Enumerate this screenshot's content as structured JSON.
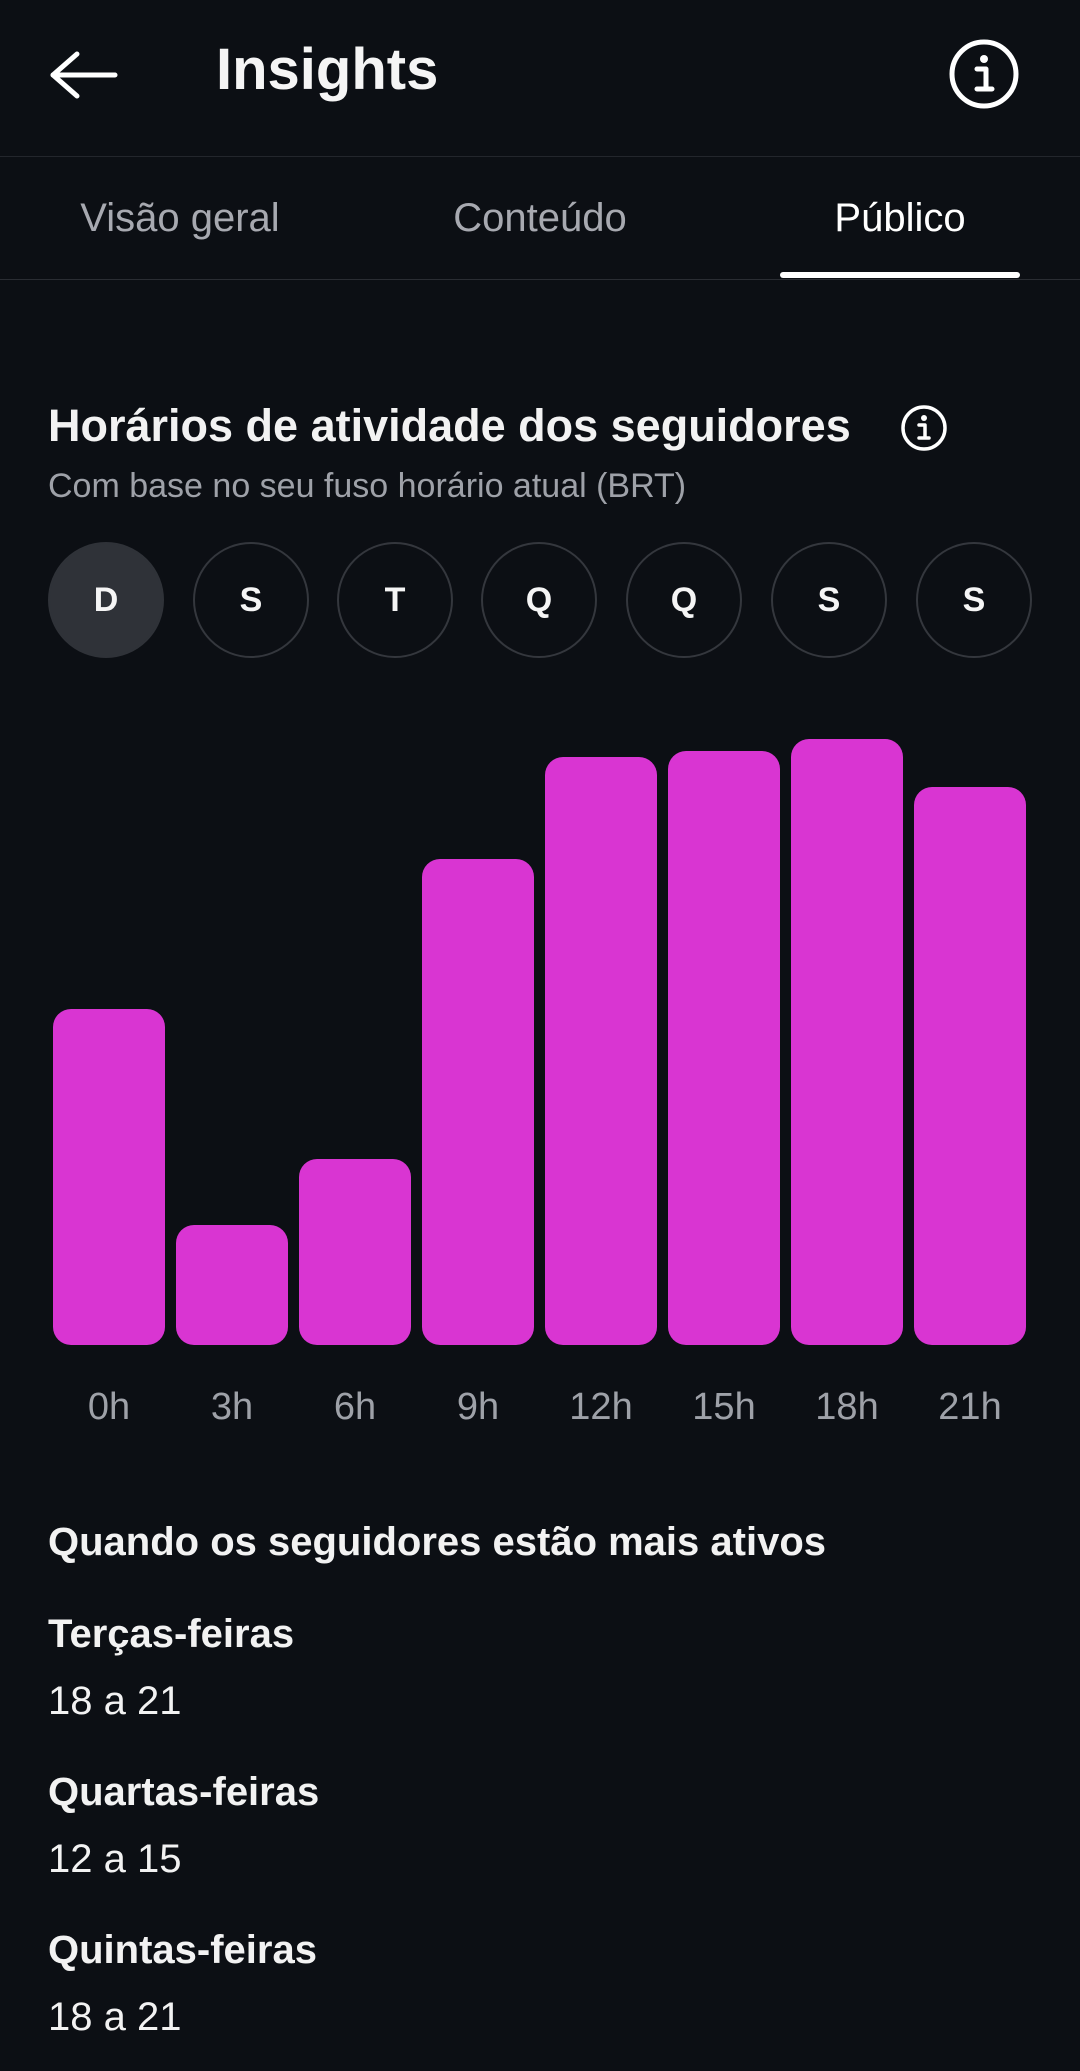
{
  "header": {
    "title": "Insights",
    "back_icon": "arrow-left-icon",
    "info_icon": "info-icon"
  },
  "tabs": [
    {
      "label": "Visão geral",
      "active": false
    },
    {
      "label": "Conteúdo",
      "active": false
    },
    {
      "label": "Público",
      "active": true
    }
  ],
  "section": {
    "title": "Horários de atividade dos seguidores",
    "subtitle": "Com base no seu fuso horário atual (BRT)",
    "info_icon": "info-icon"
  },
  "days": [
    {
      "label": "D",
      "selected": true
    },
    {
      "label": "S",
      "selected": false
    },
    {
      "label": "T",
      "selected": false
    },
    {
      "label": "Q",
      "selected": false
    },
    {
      "label": "Q",
      "selected": false
    },
    {
      "label": "S",
      "selected": false
    },
    {
      "label": "S",
      "selected": false
    }
  ],
  "chart_data": {
    "type": "bar",
    "categories": [
      "0h",
      "3h",
      "6h",
      "9h",
      "12h",
      "15h",
      "18h",
      "21h"
    ],
    "values": [
      56,
      20,
      31,
      81,
      98,
      99,
      101,
      93
    ],
    "ylim": [
      0,
      101
    ],
    "grid": false,
    "color": "#d935d2"
  },
  "most_active": {
    "title": "Quando os seguidores estão mais ativos",
    "items": [
      {
        "day": "Terças-feiras",
        "range": "18 a 21"
      },
      {
        "day": "Quartas-feiras",
        "range": "12 a 15"
      },
      {
        "day": "Quintas-feiras",
        "range": "18 a 21"
      }
    ]
  },
  "colors": {
    "background": "#0c0f14",
    "bar": "#d935d2",
    "muted_text": "#9ea1a8"
  }
}
